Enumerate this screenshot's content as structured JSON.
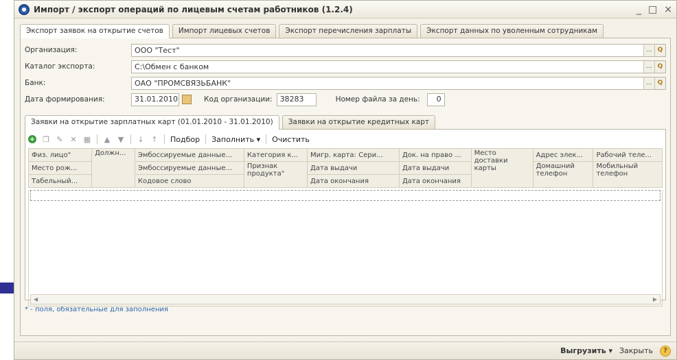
{
  "window": {
    "title": "Импорт / экспорт операций по лицевым счетам работников (1.2.4)",
    "controls": [
      "_",
      "□",
      "×"
    ]
  },
  "tabs": [
    "Экспорт заявок на открытие счетов",
    "Импорт лицевых счетов",
    "Экспорт перечисления зарплаты",
    "Экспорт данных по уволенным сотрудникам"
  ],
  "form": {
    "org_label": "Организация:",
    "org_value": "ООО \"Тест\"",
    "catalog_label": "Каталог экспорта:",
    "catalog_value": "С:\\Обмен с банком",
    "bank_label": "Банк:",
    "bank_value": "ОАО \"ПРОМСВЯЗЬБАНК\"",
    "date_label": "Дата формирования:",
    "date_value": "31.01.2010",
    "orgcode_label": "Код организации:",
    "orgcode_value": "38283",
    "filenum_label": "Номер файла за день:",
    "filenum_value": "0",
    "dots": "...",
    "search": "Q"
  },
  "inner_tabs": [
    "Заявки на открытие зарплатных карт (01.01.2010 - 31.01.2010)",
    "Заявки на открытие кредитных карт"
  ],
  "toolbar": {
    "podbor": "Подбор",
    "zapolnit": "Заполнить ▾",
    "ochistit": "Очистить"
  },
  "table": {
    "row1": [
      "Физ. лицо\"",
      "Должн...",
      "Эмбоссируемые данные...",
      "Категория к...",
      "Мигр. карта: Сери...",
      "Док. на право ...",
      "Место доставки карты",
      "Адрес элек...",
      "Рабочий теле..."
    ],
    "row2": [
      "Место рож...",
      "",
      "Эмбоссируемые данные...",
      "Признак продукта\"",
      "Дата выдачи",
      "Дата выдачи",
      "",
      "Домашний телефон",
      "Мобильный телефон"
    ],
    "row3": [
      "Табельный...",
      "",
      "Кодовое слово",
      "",
      "Дата окончания",
      "Дата окончания",
      "",
      "",
      ""
    ]
  },
  "note": "* - поля, обязательные для заполнения",
  "bottom": {
    "export": "Выгрузить ▾",
    "close": "Закрыть",
    "help": "?"
  },
  "colors": {
    "arrow": "#2e3192",
    "note": "#2b62a8"
  }
}
